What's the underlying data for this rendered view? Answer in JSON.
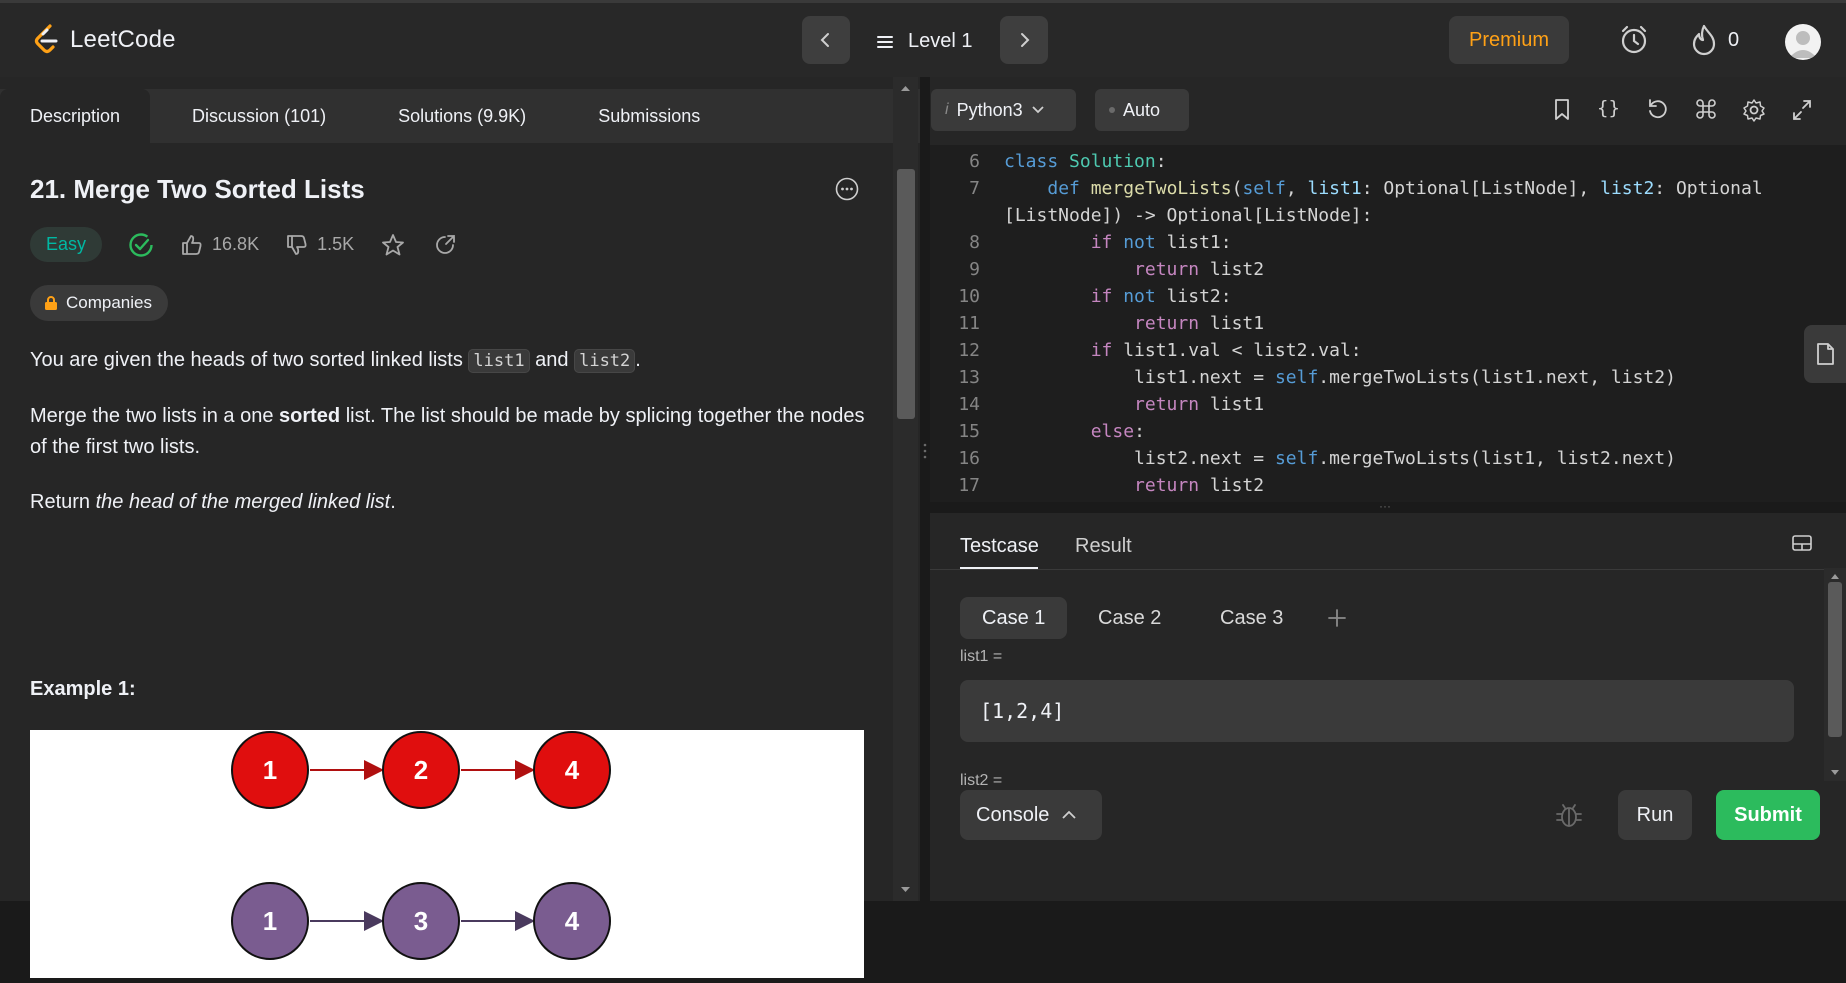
{
  "header": {
    "logo_text": "LeetCode",
    "level_label": "Level 1",
    "premium_label": "Premium",
    "streak_count": "0"
  },
  "left": {
    "tabs": [
      {
        "label": "Description"
      },
      {
        "label": "Discussion (101)"
      },
      {
        "label": "Solutions (9.9K)"
      },
      {
        "label": "Submissions"
      }
    ],
    "title": "21. Merge Two Sorted Lists",
    "difficulty": "Easy",
    "likes": "16.8K",
    "dislikes": "1.5K",
    "companies_label": "Companies",
    "desc": {
      "p1_a": "You are given the heads of two sorted linked lists ",
      "p1_code1": "list1",
      "p1_b": " and ",
      "p1_code2": "list2",
      "p1_c": ".",
      "p2_a": "Merge the two lists in a one ",
      "p2_bold": "sorted",
      "p2_b": " list. The list should be made by splicing together the nodes of the first two lists.",
      "p3_a": "Return ",
      "p3_em": "the head of the merged linked list",
      "p3_b": "."
    },
    "example_title": "Example 1:",
    "example_lists": {
      "list1": [
        "1",
        "2",
        "4"
      ],
      "list2": [
        "1",
        "3",
        "4"
      ]
    },
    "colors": {
      "list1_node": "#e00e0e",
      "list2_node": "#7a5c90",
      "easy": "#00b8a3"
    }
  },
  "editor": {
    "language": "Python3",
    "mode": "Auto",
    "lines": [
      {
        "n": "6",
        "tokens": [
          [
            "df",
            "class "
          ],
          [
            "cls",
            "Solution"
          ],
          [
            "txt",
            ":"
          ]
        ]
      },
      {
        "n": "7",
        "tokens": [
          [
            "txt",
            "    "
          ],
          [
            "df",
            "def "
          ],
          [
            "fn",
            "mergeTwoLists"
          ],
          [
            "txt",
            "("
          ],
          [
            "slf",
            "self"
          ],
          [
            "txt",
            ", "
          ],
          [
            "prm",
            "list1"
          ],
          [
            "txt",
            ": Optional[ListNode], "
          ],
          [
            "prm",
            "list2"
          ],
          [
            "txt",
            ": Optional"
          ]
        ]
      },
      {
        "n": "",
        "tokens": [
          [
            "txt",
            "[ListNode]) -> Optional[ListNode]:"
          ]
        ]
      },
      {
        "n": "8",
        "tokens": [
          [
            "txt",
            "        "
          ],
          [
            "kw",
            "if "
          ],
          [
            "df",
            "not "
          ],
          [
            "txt",
            "list1:"
          ]
        ]
      },
      {
        "n": "9",
        "tokens": [
          [
            "txt",
            "            "
          ],
          [
            "kw",
            "return "
          ],
          [
            "txt",
            "list2"
          ]
        ]
      },
      {
        "n": "10",
        "tokens": [
          [
            "txt",
            "        "
          ],
          [
            "kw",
            "if "
          ],
          [
            "df",
            "not "
          ],
          [
            "txt",
            "list2:"
          ]
        ]
      },
      {
        "n": "11",
        "tokens": [
          [
            "txt",
            "            "
          ],
          [
            "kw",
            "return "
          ],
          [
            "txt",
            "list1"
          ]
        ]
      },
      {
        "n": "12",
        "tokens": [
          [
            "txt",
            "        "
          ],
          [
            "kw",
            "if "
          ],
          [
            "txt",
            "list1.val < list2.val:"
          ]
        ]
      },
      {
        "n": "13",
        "tokens": [
          [
            "txt",
            "            list1.next = "
          ],
          [
            "slf",
            "self"
          ],
          [
            "txt",
            ".mergeTwoLists(list1.next, list2)"
          ]
        ]
      },
      {
        "n": "14",
        "tokens": [
          [
            "txt",
            "            "
          ],
          [
            "kw",
            "return "
          ],
          [
            "txt",
            "list1"
          ]
        ]
      },
      {
        "n": "15",
        "tokens": [
          [
            "txt",
            "        "
          ],
          [
            "kw",
            "else"
          ],
          [
            "txt",
            ":"
          ]
        ]
      },
      {
        "n": "16",
        "tokens": [
          [
            "txt",
            "            list2.next = "
          ],
          [
            "slf",
            "self"
          ],
          [
            "txt",
            ".mergeTwoLists(list1, list2.next)"
          ]
        ]
      },
      {
        "n": "17",
        "tokens": [
          [
            "txt",
            "            "
          ],
          [
            "kw",
            "return "
          ],
          [
            "txt",
            "list2"
          ]
        ]
      }
    ]
  },
  "testcase": {
    "tabs": [
      {
        "label": "Testcase"
      },
      {
        "label": "Result"
      }
    ],
    "cases": [
      {
        "label": "Case 1"
      },
      {
        "label": "Case 2"
      },
      {
        "label": "Case 3"
      }
    ],
    "list1_label": "list1 =",
    "list1_value": "[1,2,4]",
    "list2_label": "list2 =",
    "console_label": "Console",
    "run_label": "Run",
    "submit_label": "Submit"
  }
}
